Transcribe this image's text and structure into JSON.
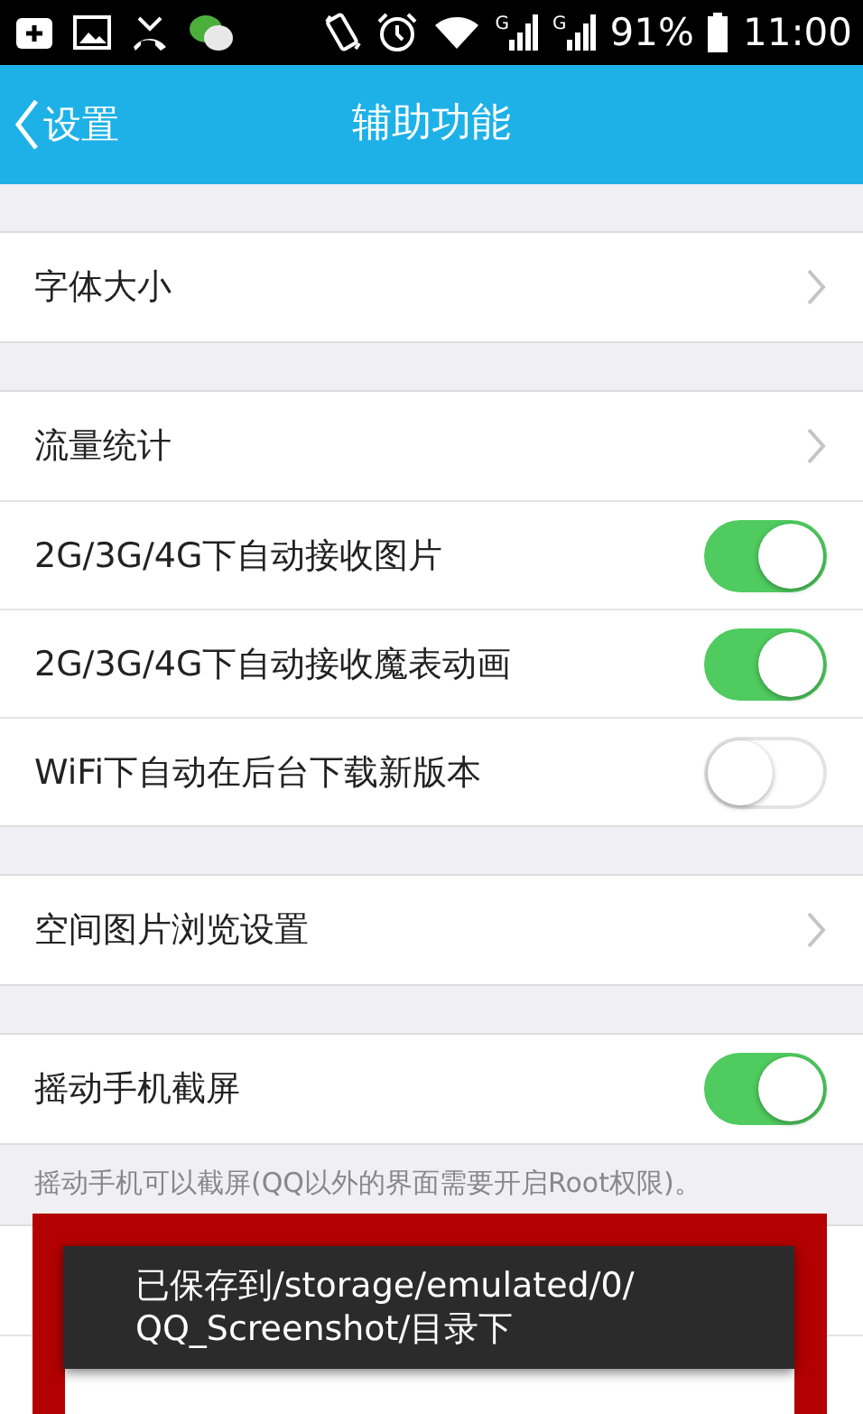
{
  "status_bar": {
    "signals": [
      {
        "label": "G"
      },
      {
        "label": "G"
      }
    ],
    "battery": "91%",
    "time": "11:00"
  },
  "header": {
    "back": "设置",
    "title": "辅助功能"
  },
  "groups": [
    {
      "items": [
        {
          "kind": "link",
          "label": "字体大小"
        }
      ]
    },
    {
      "items": [
        {
          "kind": "link",
          "label": "流量统计"
        },
        {
          "kind": "toggle",
          "label": "2G/3G/4G下自动接收图片",
          "on": true
        },
        {
          "kind": "toggle",
          "label": "2G/3G/4G下自动接收魔表动画",
          "on": true
        },
        {
          "kind": "toggle",
          "label": "WiFi下自动在后台下载新版本",
          "on": false
        }
      ]
    },
    {
      "items": [
        {
          "kind": "link",
          "label": "空间图片浏览设置"
        }
      ]
    },
    {
      "items": [
        {
          "kind": "toggle",
          "label": "摇动手机截屏",
          "on": true
        }
      ],
      "note": "摇动手机可以截屏(QQ以外的界面需要开启Root权限)。"
    }
  ],
  "toast": {
    "lines": [
      "已保存到/storage/emulated/0/",
      "QQ_Screenshot/目录下"
    ]
  }
}
